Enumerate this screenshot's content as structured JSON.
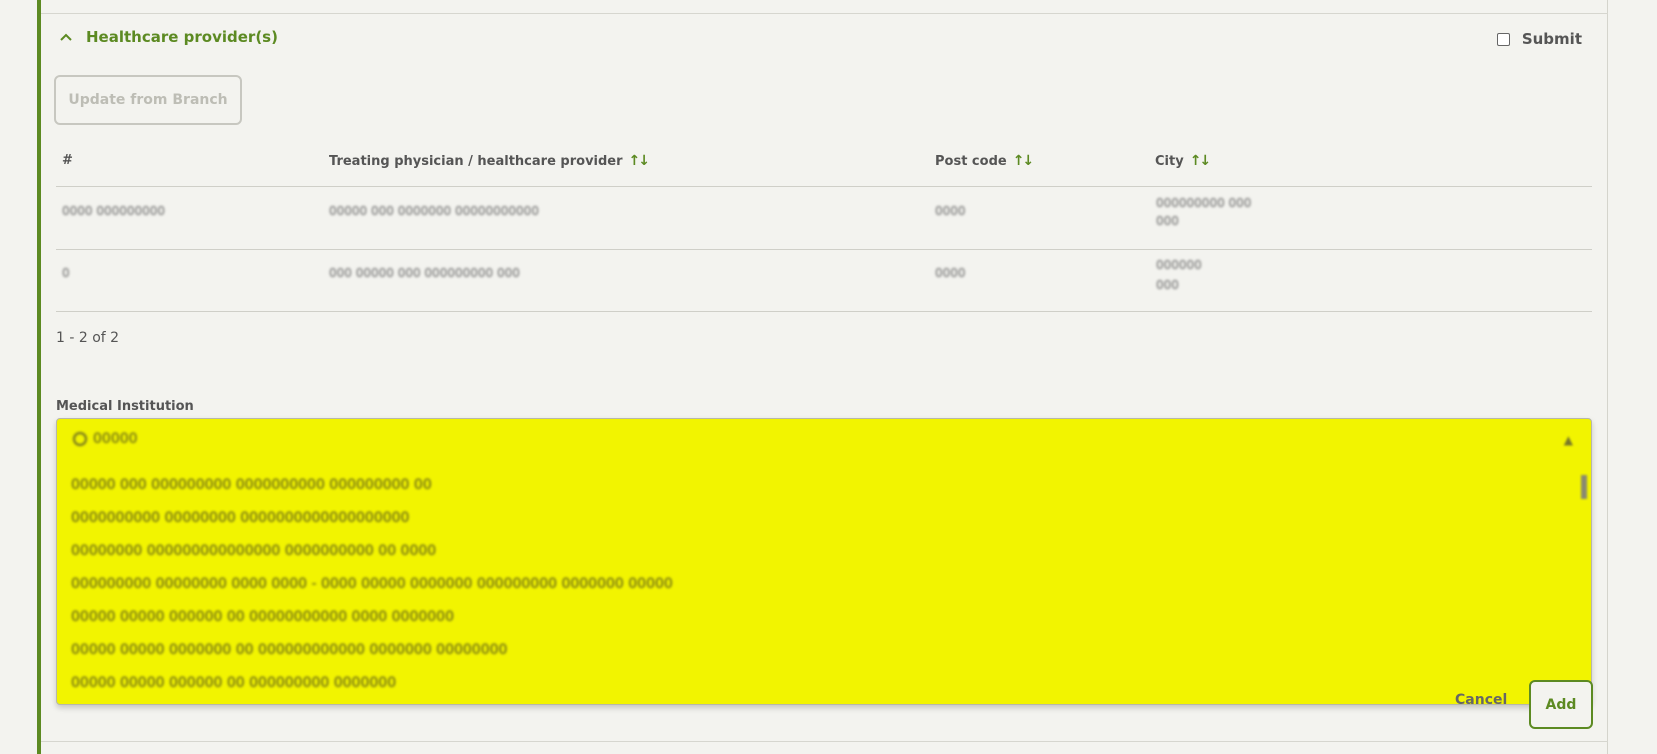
{
  "section": {
    "title": "Healthcare provider(s)",
    "submit_label": "Submit"
  },
  "toolbar": {
    "update_label": "Update from Branch"
  },
  "table": {
    "headers": [
      "#",
      "Treating physician / healthcare provider",
      "Post code",
      "City"
    ],
    "rows": [
      {
        "id": "0000 000000000",
        "provider": "00000 000 0000000 00000000000",
        "postcode": "0000",
        "city": "000000000 000",
        "city2": "000"
      },
      {
        "id": "0",
        "provider": "000 00000 000 000000000 000",
        "postcode": "0000",
        "city": "000000",
        "city2": "000"
      }
    ]
  },
  "pager": {
    "text": "1 - 2 of 2"
  },
  "medical_institution": {
    "label": "Medical Institution",
    "search_value": "00000",
    "options": [
      "00000 000 000000000 0000000000 000000000 00",
      "0000000000 00000000 0000000000000000000",
      "00000000 000000000000000 0000000000 00 0000",
      "000000000 00000000 0000 0000 - 0000 00000 0000000 000000000 0000000 00000",
      "00000 00000 000000 00 00000000000 0000 0000000",
      "00000 00000 0000000 00 000000000000 0000000 00000000",
      "00000 00000 000000 00 000000000 0000000"
    ]
  },
  "actions": {
    "cancel_label": "Cancel",
    "add_label": "Add"
  },
  "colors": {
    "accent": "#5c8a22",
    "highlight": "#f2f400",
    "background": "#f3f3ef"
  }
}
